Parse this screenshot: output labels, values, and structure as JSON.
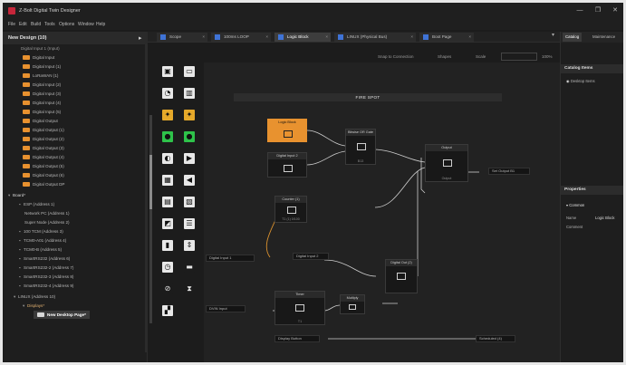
{
  "window": {
    "title": "Z-Bolt Digital Twin Designer",
    "controls": [
      "—",
      "❐",
      "✕"
    ]
  },
  "menu": [
    "File",
    "Edit",
    "Build",
    "Tools",
    "Options",
    "Window",
    "Help"
  ],
  "left_panel": {
    "title": "New Design (10)",
    "root": "Digital Input 1 (Input)",
    "items": [
      "Digital Input",
      "Digital Input (1)",
      "LoRaWAN (1)",
      "Digital Input (2)",
      "Digital Input (3)",
      "Digital Input (4)",
      "Digital Input (5)",
      "Digital Output",
      "Digital Output (1)",
      "Digital Output (2)",
      "Digital Output (3)",
      "Digital Output (4)",
      "Digital Output (5)",
      "Digital Output (6)",
      "Digital Output DP"
    ],
    "group": "Board*",
    "sub_items": [
      "ESP (Address 1)",
      "Network PC (Address 1)",
      "Super Node (Address 2)",
      "100 TCM (Address 3)",
      "TCM0-A01 (Address 4)",
      "TCM0-B (Address 5)",
      "SmartRS232 (Address 6)",
      "SmartRS232-2 (Address 7)",
      "SmartRS232-3 (Address 8)",
      "SmartRS232-4 (Address 9)"
    ],
    "lower": "LINUX (Address 10)",
    "lower_sub": "Displays*",
    "selected": "New Desktop Page*"
  },
  "tabs": [
    {
      "label": "Scope",
      "active": false
    },
    {
      "label": "100ms LOOP",
      "active": false
    },
    {
      "label": "Logic Block",
      "active": true
    },
    {
      "label": "LINUX (Physical Bus)",
      "active": false
    },
    {
      "label": "Boot Page",
      "active": false
    }
  ],
  "toolbar": {
    "snap": "Snap to Connection",
    "shape": "Shapes",
    "scale_label": "Scale",
    "zoom": "100%"
  },
  "canvas": {
    "banner": "FIRE SPOT",
    "nodes": [
      {
        "title": "Logic Block",
        "foot": ""
      },
      {
        "title": "Bitwise OR Gate",
        "foot": ""
      },
      {
        "title": "Digital Out",
        "foot": "B13"
      },
      {
        "title": "Output",
        "foot": "Output"
      },
      {
        "title": "Counter (1)",
        "foot": "T1 (1) 0/100"
      },
      {
        "title": "Digital Out (2)",
        "foot": ""
      },
      {
        "title": "Timer",
        "foot": "T1"
      },
      {
        "title": "Multiply",
        "foot": ""
      }
    ],
    "inputs": [
      "Digital Input 1",
      "Digital Input 2",
      "DVIN Input",
      "Display Button"
    ],
    "outputs": [
      "Set Output B1",
      "Scheduled (4)"
    ]
  },
  "right_panel": {
    "tabs": [
      "Catalog",
      "Maintenance"
    ],
    "catalog_title": "Catalog Items",
    "catalog_item": "Desktop Items",
    "properties_title": "Properties",
    "section": "Common",
    "rows": [
      {
        "k": "Name",
        "v": "Logic Block"
      },
      {
        "k": "Comment",
        "v": ""
      }
    ]
  }
}
